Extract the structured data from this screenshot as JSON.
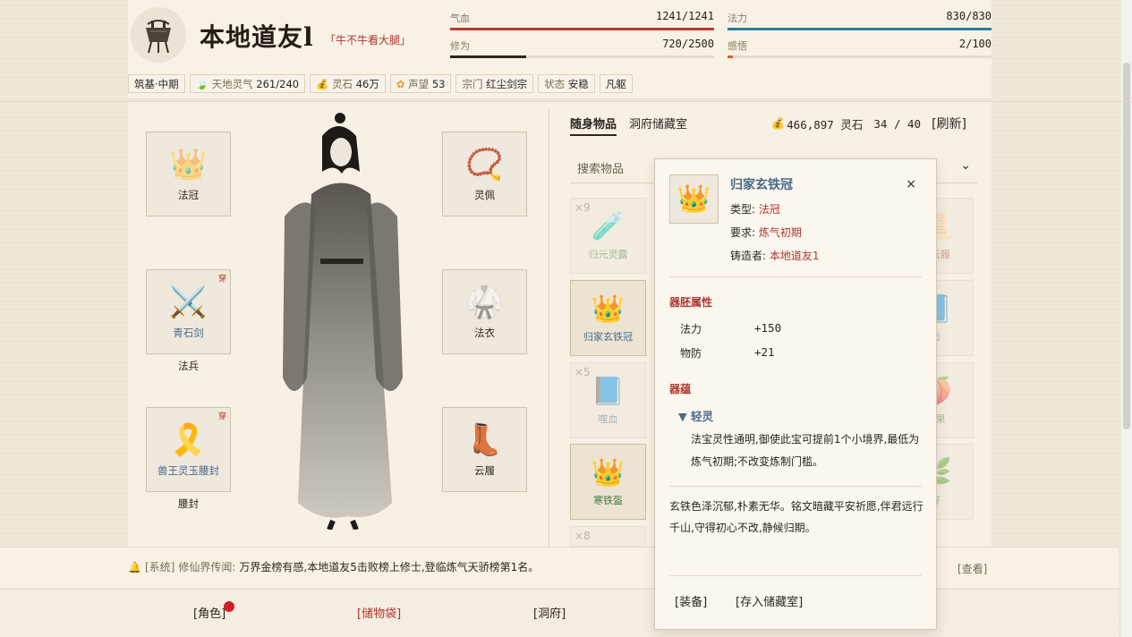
{
  "header": {
    "name": "本地道友l",
    "title": "「牛不牛看大腿」",
    "stats": [
      {
        "label": "气血",
        "value": "1241/1241",
        "fraction": 1.0,
        "color": "#c0392b"
      },
      {
        "label": "法力",
        "value": "830/830",
        "fraction": 1.0,
        "color": "#2f7a9a"
      },
      {
        "label": "修为",
        "value": "720/2500",
        "fraction": 0.288,
        "color": "#2b2620"
      },
      {
        "label": "感悟",
        "value": "2/100",
        "fraction": 0.02,
        "color": "#d0622b"
      }
    ],
    "tags": {
      "realm": "筑基·中期",
      "qi_label": "天地灵气",
      "qi_value": "261/240",
      "stone_label": "灵石",
      "stone_value": "46万",
      "fame_label": "声望",
      "fame_value": "53",
      "sect_label": "宗门",
      "sect_value": "红尘剑宗",
      "state_label": "状态",
      "state_value": "安稳",
      "body": "凡躯"
    }
  },
  "equipment": {
    "crown": "法冠",
    "pendant": "灵佩",
    "weapon_name": "青石剑",
    "weapon_slot": "法兵",
    "robe": "法衣",
    "belt_name": "兽王灵玉腰封",
    "belt_slot": "腰封",
    "boots": "云履",
    "worn": "穿"
  },
  "inventory": {
    "tab_bag": "随身物品",
    "tab_storage": "洞府储藏室",
    "money": "466,897 灵石",
    "capacity": "34 / 40",
    "refresh": "[刷新]",
    "search_placeholder": "搜索物品",
    "items": {
      "item1_count": "×9",
      "item1_name": "归元灵露",
      "item2_name": "归家玄铁冠",
      "item3_count": "×5",
      "item3_name": "噬血",
      "item4_name": "寒铁盔",
      "item5_count": "×8",
      "right1_name": "归云履",
      "right2_name": "击",
      "right3_name": "灵果",
      "right4_name": "籽"
    }
  },
  "tooltip": {
    "name": "归家玄铁冠",
    "close": "×",
    "type_label": "类型:",
    "type_value": "法冠",
    "req_label": "要求:",
    "req_value": "炼气初期",
    "maker_label": "铸造者:",
    "maker_value": "本地道友1",
    "section_attr": "器胚属性",
    "attr1_name": "法力",
    "attr1_value": "+150",
    "attr2_name": "物防",
    "attr2_value": "+21",
    "section_aura": "器蕴",
    "aura_name": "▼ 轻灵",
    "aura_desc": "法宝灵性通明,御使此宝可提前1个小境界,最低为炼气初期;不改变炼制门槛。",
    "lore": "玄铁色泽沉郁,朴素无华。铭文暗藏平安祈愿,伴君远行千山,守得初心不改,静候归期。",
    "btn_equip": "[装备]",
    "btn_store": "[存入储藏室]"
  },
  "news": {
    "system": "[系统]",
    "source": "修仙界传闻:",
    "message": "万界金榜有感,本地道友5击败榜上修士,登临炼气天骄榜第1名。",
    "view": "[查看]"
  },
  "nav": {
    "role": "[角色]",
    "bag": "[储物袋]",
    "cave": "[洞府]"
  },
  "colors": {
    "accent_red": "#b0352f",
    "item_blue": "#4a6a8a",
    "item_green": "#3c7a3a"
  }
}
